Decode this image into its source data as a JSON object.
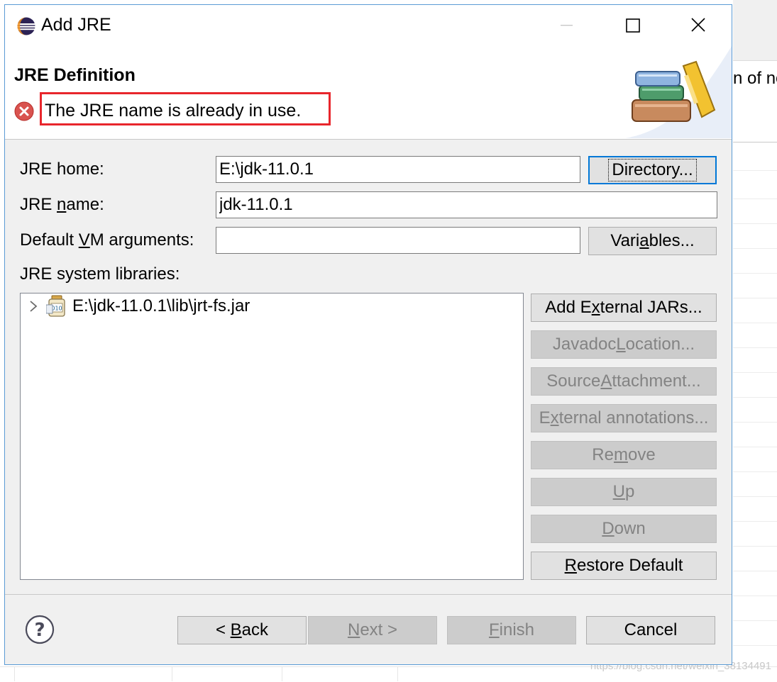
{
  "dialog": {
    "title": "Add JRE",
    "header_title": "JRE Definition",
    "error_message": "The JRE name is already in use."
  },
  "form": {
    "jre_home_label": "JRE home:",
    "jre_home_value": "E:\\jdk-11.0.1",
    "directory_button": "Directory...",
    "jre_name_label_pre": "JRE ",
    "jre_name_label_u": "n",
    "jre_name_label_post": "ame:",
    "jre_name_value": "jdk-11.0.1",
    "vm_args_label_pre": "Default ",
    "vm_args_label_u": "V",
    "vm_args_label_post": "M arguments:",
    "vm_args_value": "",
    "variables_button_pre": "Vari",
    "variables_button_u": "a",
    "variables_button_post": "bles...",
    "libraries_label": "JRE system libraries:"
  },
  "libraries": {
    "items": [
      {
        "label": "E:\\jdk-11.0.1\\lib\\jrt-fs.jar"
      }
    ]
  },
  "library_buttons": {
    "add_external_pre": "Add E",
    "add_external_u": "x",
    "add_external_post": "ternal JARs...",
    "javadoc_pre": "Javadoc ",
    "javadoc_u": "L",
    "javadoc_post": "ocation...",
    "source_pre": "Source ",
    "source_u": "A",
    "source_post": "ttachment...",
    "ext_ann_pre": "E",
    "ext_ann_u": "x",
    "ext_ann_post": "ternal annotations...",
    "remove_pre": "Re",
    "remove_u": "m",
    "remove_post": "ove",
    "up_u": "U",
    "up_post": "p",
    "down_u": "D",
    "down_post": "own",
    "restore_u": "R",
    "restore_post": "estore Default"
  },
  "footer": {
    "back_pre": "< ",
    "back_u": "B",
    "back_post": "ack",
    "next_u": "N",
    "next_post": "ext >",
    "finish_u": "F",
    "finish_post": "inish",
    "cancel": "Cancel"
  },
  "background": {
    "text_fragment": "n of ne",
    "watermark": "https://blog.csdn.net/weixin_38134491"
  },
  "icons": {
    "app": "eclipse-icon",
    "error": "error-icon",
    "help": "help-icon",
    "jar": "jar-icon",
    "header_art": "jre-books-icon"
  },
  "colors": {
    "highlight_box": "#e8262c",
    "error_icon": "#d9534f",
    "dialog_border": "#5b9bd5",
    "focus": "#0078d7"
  }
}
